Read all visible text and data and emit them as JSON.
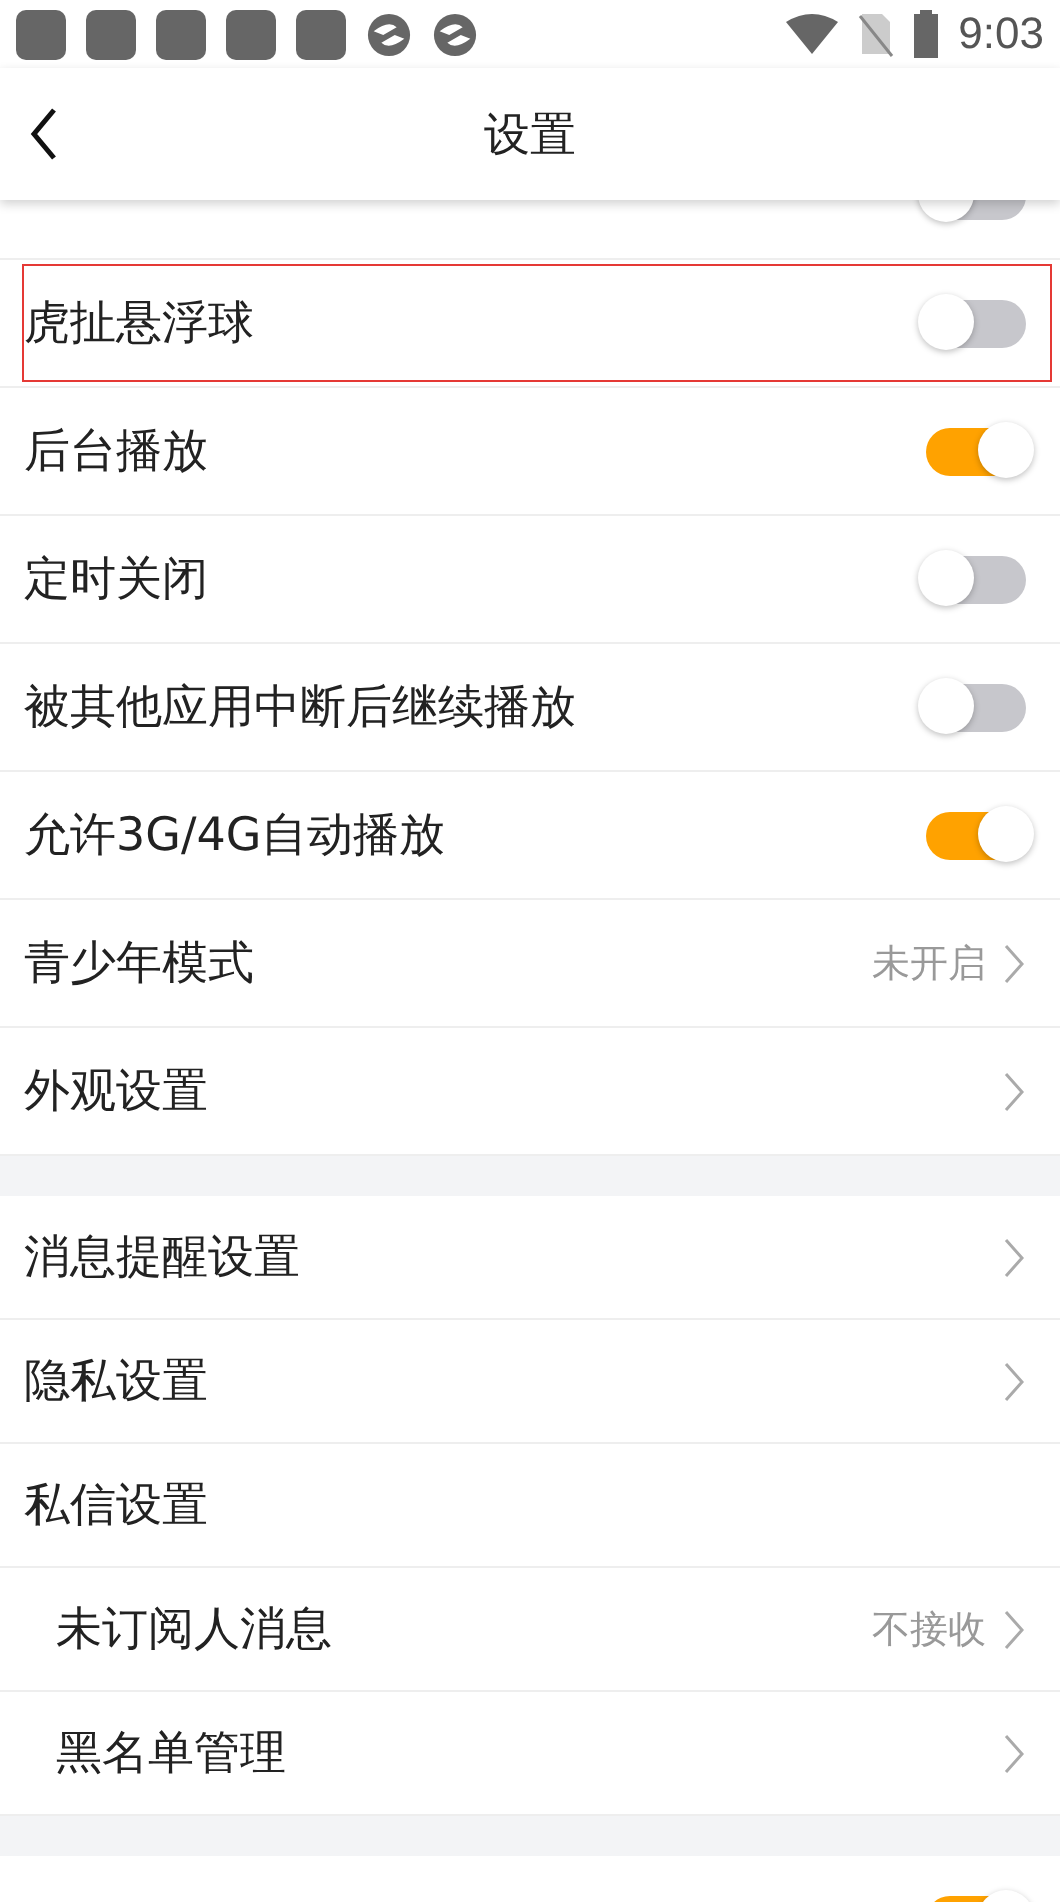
{
  "status_bar": {
    "time": "9:03"
  },
  "header": {
    "title": "设置"
  },
  "sections": [
    {
      "items": [
        {
          "kind": "toggle",
          "on": false,
          "highlighted": false
        },
        {
          "label": "虎扯悬浮球",
          "kind": "toggle",
          "on": false,
          "highlighted": true
        },
        {
          "label": "后台播放",
          "kind": "toggle",
          "on": true,
          "highlighted": false
        },
        {
          "label": "定时关闭",
          "kind": "toggle",
          "on": false,
          "highlighted": false
        },
        {
          "label": "被其他应用中断后继续播放",
          "kind": "toggle",
          "on": false,
          "highlighted": false
        },
        {
          "label": "允许3G/4G自动播放",
          "kind": "toggle",
          "on": true,
          "highlighted": false
        },
        {
          "label": "青少年模式",
          "kind": "link",
          "value": "未开启",
          "highlighted": false
        },
        {
          "label": "外观设置",
          "kind": "link",
          "highlighted": false
        }
      ]
    },
    {
      "items": [
        {
          "label": "消息提醒设置",
          "kind": "link",
          "highlighted": false
        },
        {
          "label": "隐私设置",
          "kind": "link",
          "highlighted": false
        },
        {
          "label": "私信设置",
          "kind": "group",
          "highlighted": false,
          "children": [
            {
              "label": "未订阅人消息",
              "kind": "link",
              "value": "不接收",
              "highlighted": false
            },
            {
              "label": "黑名单管理",
              "kind": "link",
              "highlighted": false
            }
          ]
        }
      ]
    },
    {
      "items": [
        {
          "kind": "toggle",
          "on": true,
          "highlighted": false
        }
      ]
    }
  ]
}
